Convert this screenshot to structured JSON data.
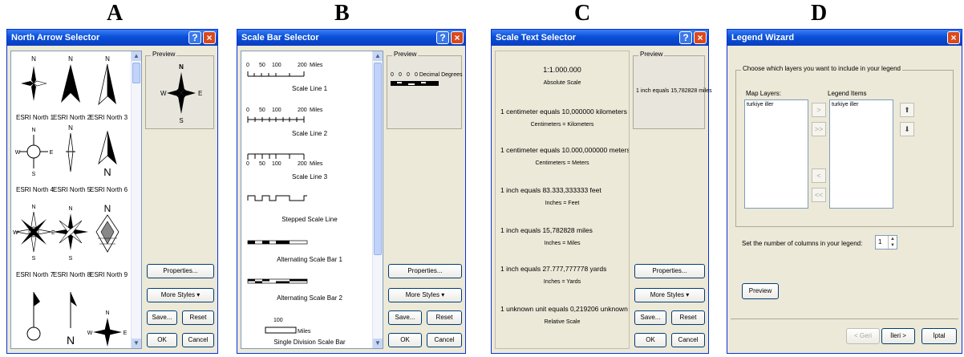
{
  "letters": [
    "A",
    "B",
    "C",
    "D"
  ],
  "north": {
    "title": "North Arrow Selector",
    "preview_label": "Preview",
    "compass": [
      "N",
      "E",
      "S",
      "W"
    ],
    "items": [
      "ESRI North 1",
      "ESRI North 2",
      "ESRI North 3",
      "ESRI North 4",
      "ESRI North 5",
      "ESRI North 6",
      "ESRI North 7",
      "ESRI North 8",
      "ESRI North 9"
    ],
    "buttons": {
      "properties": "Properties...",
      "more_styles": "More Styles",
      "save": "Save...",
      "reset": "Reset",
      "ok": "OK",
      "cancel": "Cancel"
    }
  },
  "scalebar": {
    "title": "Scale Bar Selector",
    "preview_label": "Preview",
    "ticks": [
      "0",
      "50",
      "100",
      "200"
    ],
    "unit": "Miles",
    "preview_ticks": [
      "0",
      "0",
      "0"
    ],
    "preview_unit": "0 Decimal Degrees",
    "items": [
      "Scale Line 1",
      "Scale Line 2",
      "Scale Line 3",
      "Stepped Scale Line",
      "Alternating Scale Bar 1",
      "Alternating Scale Bar 2",
      "Single Division Scale Bar"
    ],
    "single_tick": "100",
    "buttons": {
      "properties": "Properties...",
      "more_styles": "More Styles",
      "save": "Save...",
      "reset": "Reset",
      "ok": "OK",
      "cancel": "Cancel"
    }
  },
  "scaletext": {
    "title": "Scale Text Selector",
    "preview_label": "Preview",
    "preview_text": "1 inch equals 15,782828 miles",
    "items": [
      {
        "main": "1:1.000.000",
        "sub": "Absolute Scale"
      },
      {
        "main": "1 centimeter equals 10,000000 kilometers",
        "sub": "Centimeters = Kilometers"
      },
      {
        "main": "1 centimeter equals 10.000,000000 meters",
        "sub": "Centimeters = Meters"
      },
      {
        "main": "1 inch equals 83.333,333333 feet",
        "sub": "Inches = Feet"
      },
      {
        "main": "1 inch equals 15,782828 miles",
        "sub": "Inches = Miles"
      },
      {
        "main": "1 inch equals 27.777,777778 yards",
        "sub": "Inches = Yards"
      },
      {
        "main": "1 unknown unit equals 0,219206 unknown units",
        "sub": "Relative Scale"
      }
    ],
    "buttons": {
      "properties": "Properties...",
      "more_styles": "More Styles",
      "save": "Save...",
      "reset": "Reset",
      "ok": "OK",
      "cancel": "Cancel"
    }
  },
  "legend": {
    "title": "Legend Wizard",
    "group_label": "Choose which layers you want to include in your legend",
    "map_layers_label": "Map Layers:",
    "legend_items_label": "Legend Items",
    "map_layers": [
      "turkiye iller"
    ],
    "legend_items": [
      "turkiye iller"
    ],
    "columns_label": "Set the number of columns in your legend:",
    "columns_value": "1",
    "preview_button": "Preview",
    "move_buttons": [
      ">",
      ">>",
      "<",
      "<<"
    ],
    "nav": {
      "back": "< Geri",
      "next": "İleri >",
      "cancel": "İptal"
    }
  }
}
